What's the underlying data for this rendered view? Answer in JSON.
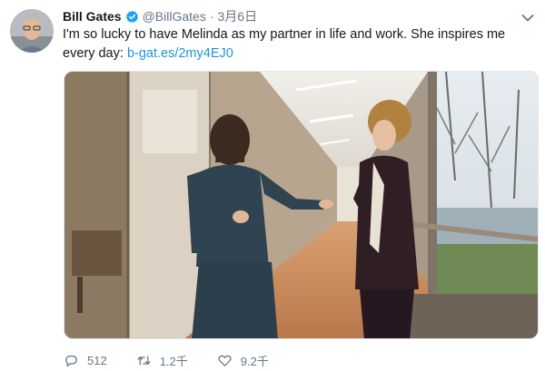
{
  "tweet": {
    "author_name": "Bill Gates",
    "handle": "@BillGates",
    "separator": "·",
    "timestamp": "3月6日",
    "text_line": "I'm so lucky to have Melinda as my partner in life and work. She inspires me every day:",
    "link": "b-gat.es/2my4EJ0",
    "colors": {
      "link": "#1b95e0",
      "verified": "#1da1f2",
      "secondary": "#657786"
    }
  },
  "actions": {
    "reply_count": "512",
    "retweet_count": "1.2千",
    "like_count": "9.2千"
  },
  "icons": {
    "verified": "verified-badge-icon",
    "caret": "chevron-down-icon",
    "reply": "reply-icon",
    "retweet": "retweet-icon",
    "like": "heart-icon"
  }
}
